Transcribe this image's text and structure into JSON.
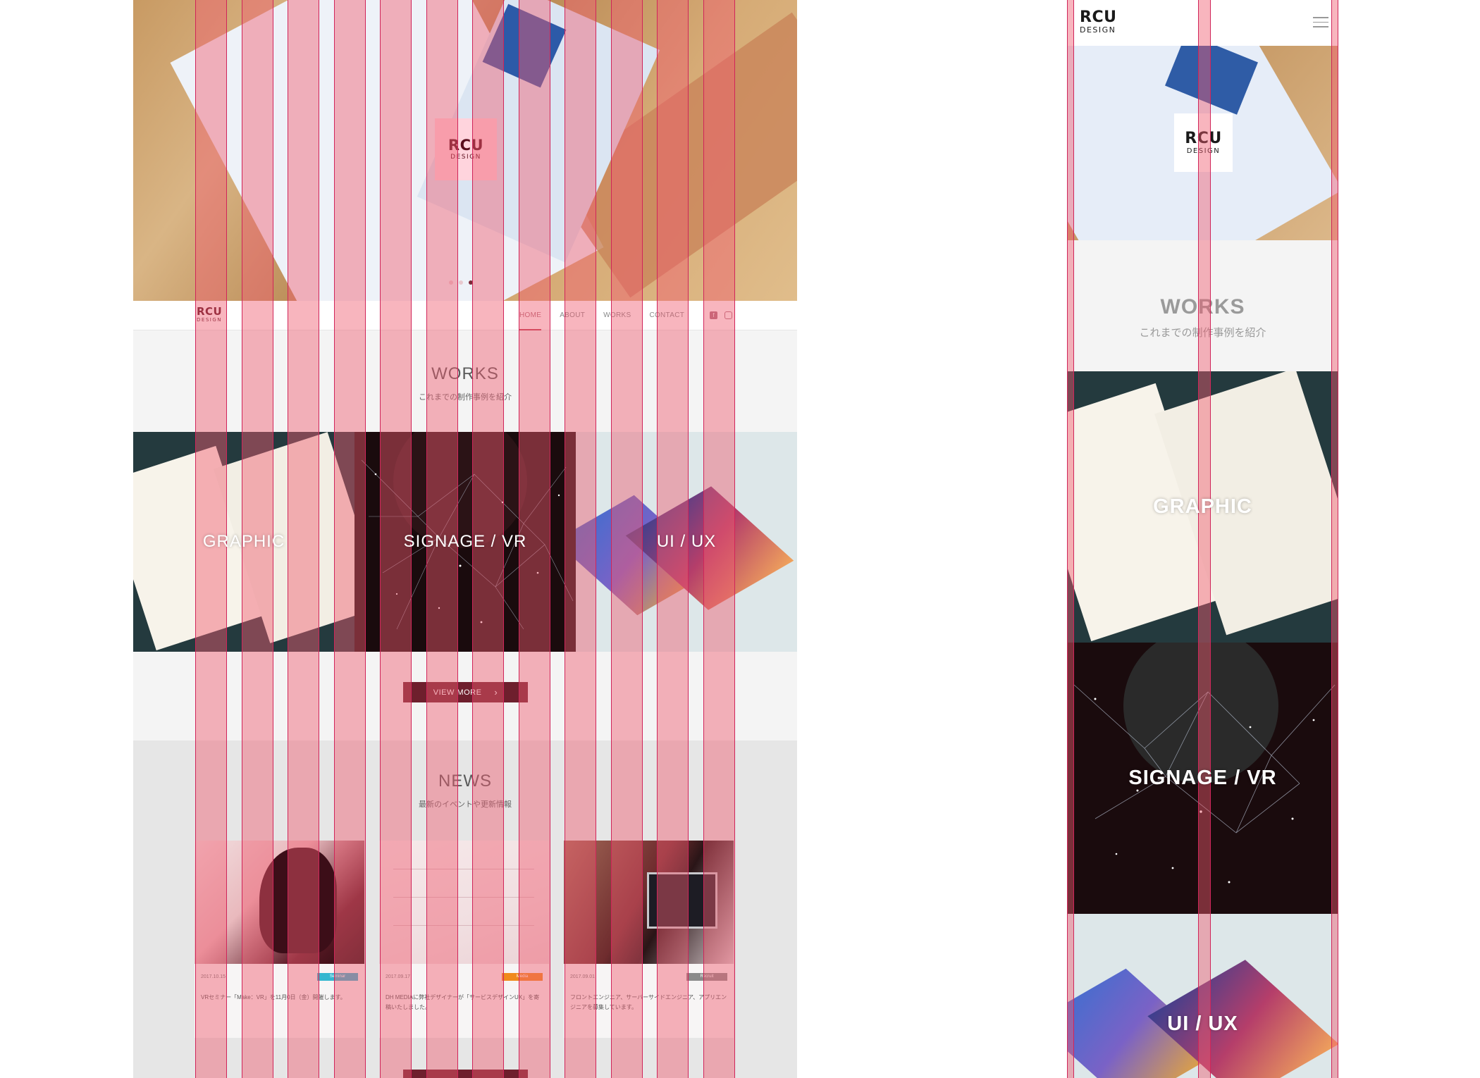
{
  "brand": {
    "name": "RCU",
    "sub": "DESIGN"
  },
  "nav": {
    "items": [
      {
        "label": "HOME",
        "active": true
      },
      {
        "label": "ABOUT"
      },
      {
        "label": "WORKS"
      },
      {
        "label": "CONTACT"
      }
    ],
    "social": [
      "facebook-icon",
      "instagram-icon"
    ]
  },
  "works": {
    "title": "WORKS",
    "subtitle": "これまでの制作事例を紹介",
    "tiles": [
      {
        "label": "GRAPHIC"
      },
      {
        "label": "SIGNAGE / VR"
      },
      {
        "label": "UI / UX"
      }
    ],
    "more_label": "VIEW  MORE"
  },
  "news": {
    "title": "NEWS",
    "subtitle": "最新のイベントや更新情報",
    "items": [
      {
        "date": "2017.10.15",
        "tag": "Seminar",
        "tag_color": "#34b7d0",
        "text": "VRセミナー「Make：VR」を11月0日（金）開催します。"
      },
      {
        "date": "2017.09.17",
        "tag": "Media",
        "tag_color": "#f08a1c",
        "text": "DH MEDIAに弊社デザイナーが「サービスデザインUX」を寄稿いたしました。"
      },
      {
        "date": "2017.09.01",
        "tag": "Recruit",
        "tag_color": "#8a8a8a",
        "text": "フロントエンジニア、サーバーサイドエンジニア、アプリエンジニアを募集しています。"
      }
    ]
  },
  "colors": {
    "accent": "#6e1f2d",
    "grid_overlay": "#f05a6e"
  }
}
